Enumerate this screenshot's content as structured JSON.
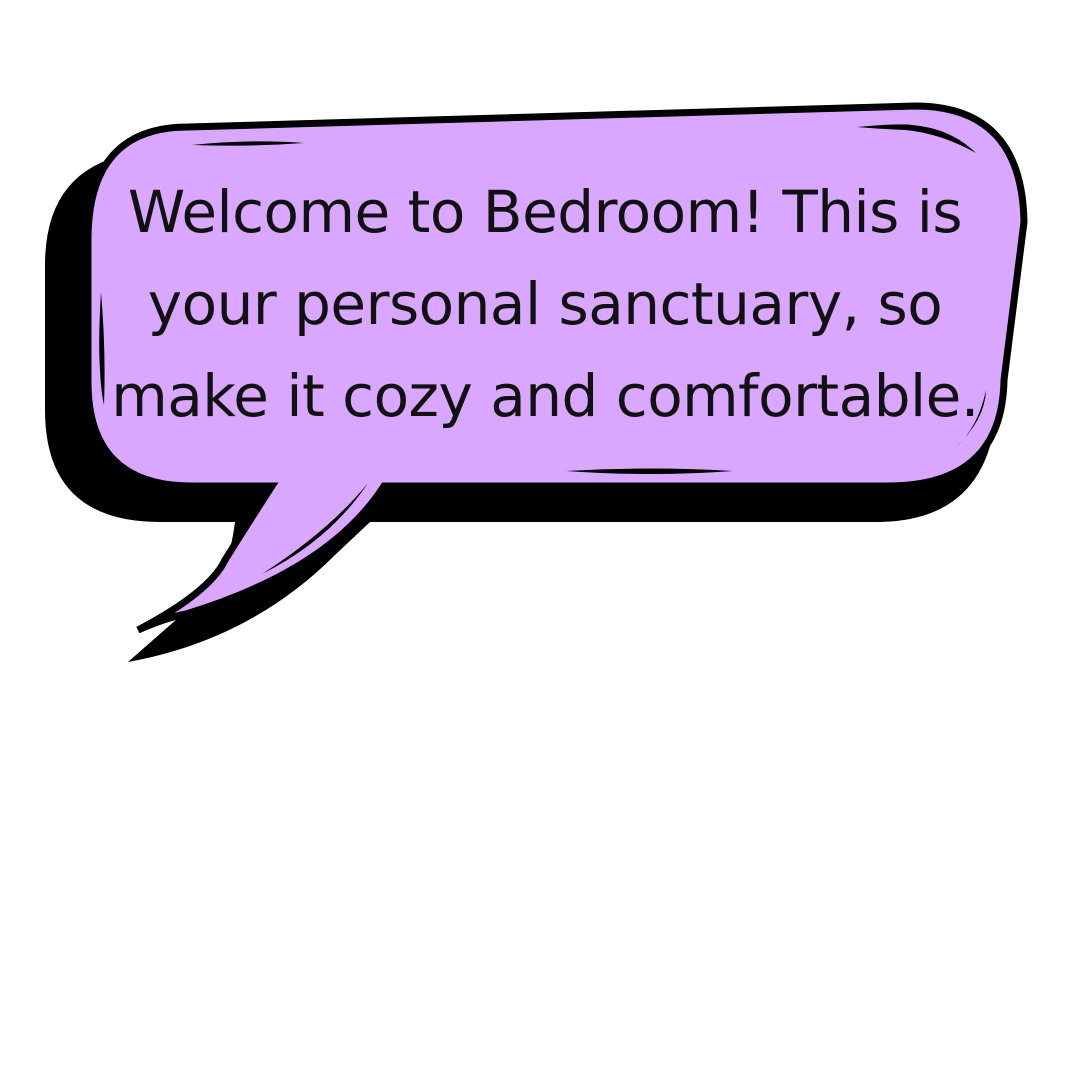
{
  "speech_bubble": {
    "fill_color": "#d9a7ff",
    "outline_color": "#000000",
    "shadow_color": "#000000",
    "lines": [
      "Welcome to Bedroom! This is",
      "your personal sanctuary, so",
      "make it cozy and comfortable."
    ]
  }
}
